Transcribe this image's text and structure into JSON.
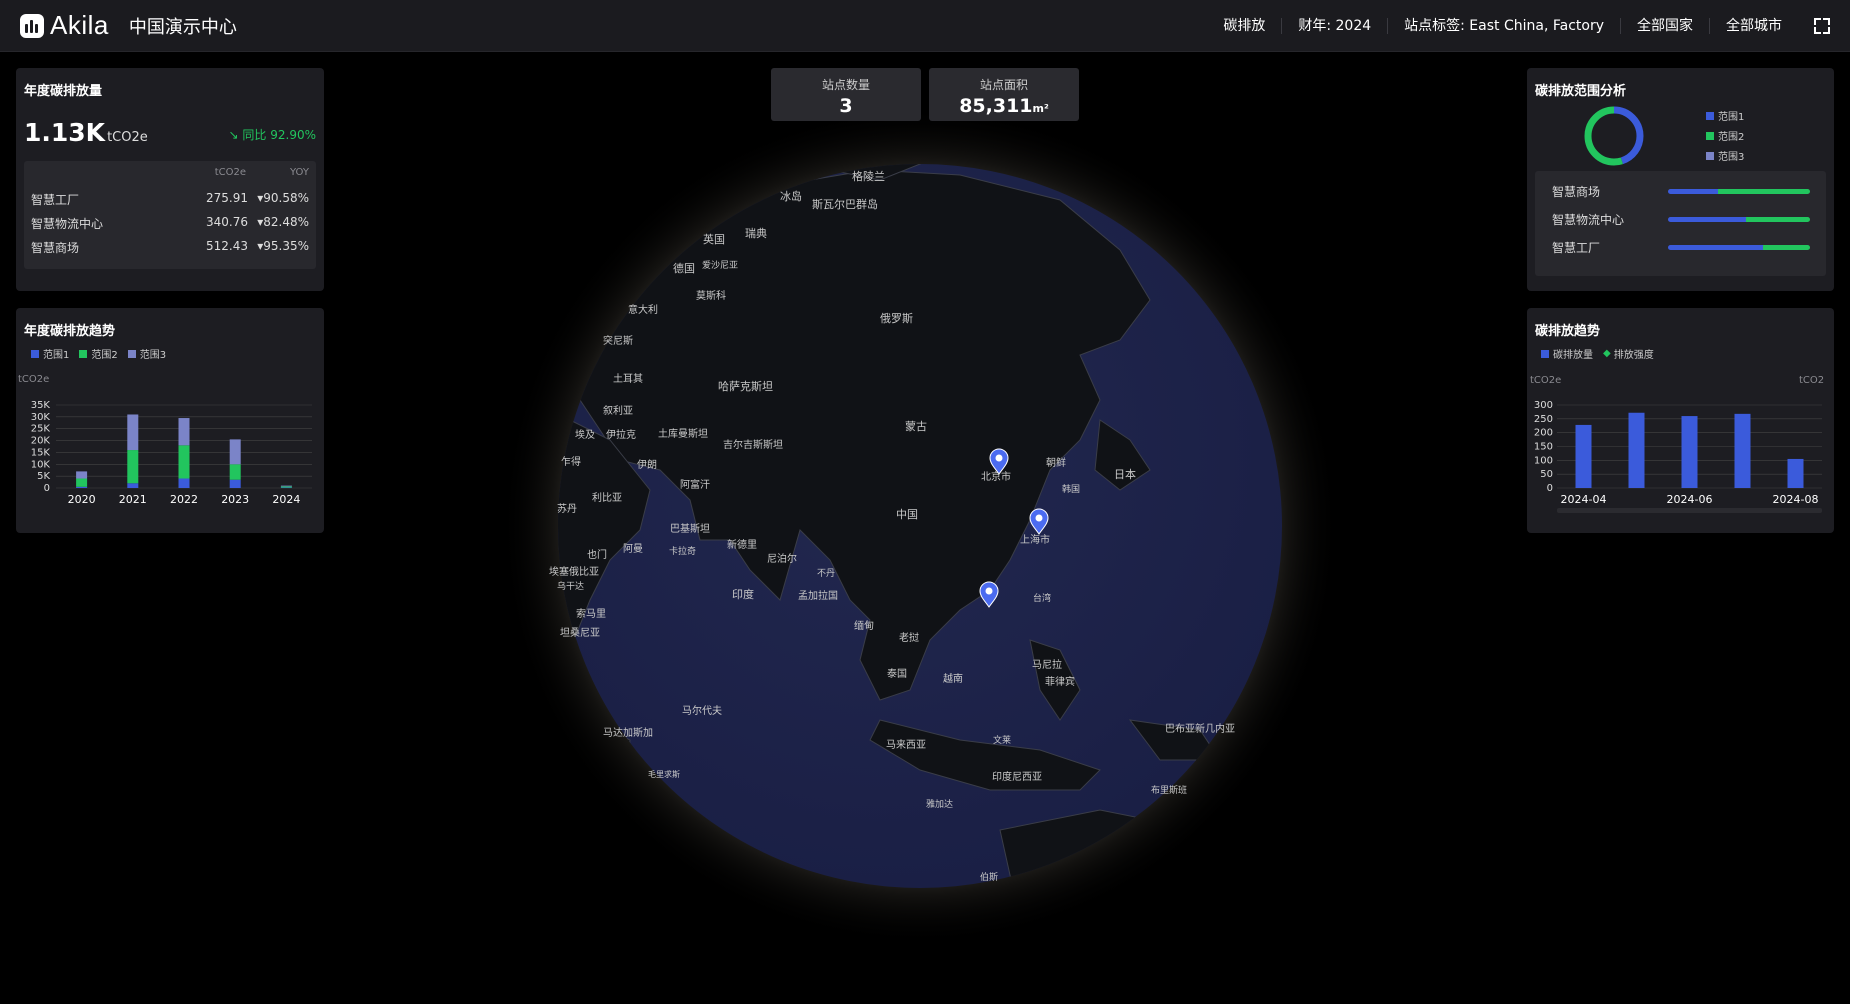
{
  "header": {
    "brand": "Akila",
    "site_title": "中国演示中心",
    "filters": [
      "碳排放",
      "财年: 2024",
      "站点标签: East China, Factory",
      "全部国家",
      "全部城市"
    ]
  },
  "annual_emission": {
    "title": "年度碳排放量",
    "value": "1.13K",
    "unit": "tCO2e",
    "yoy": "同比 92.90%",
    "col_unit": "tCO2e",
    "col_yoy": "YOY",
    "rows": [
      {
        "name": "智慧工厂",
        "value": "275.91",
        "yoy": "▾90.58%"
      },
      {
        "name": "智慧物流中心",
        "value": "340.76",
        "yoy": "▾82.48%"
      },
      {
        "name": "智慧商场",
        "value": "512.43",
        "yoy": "▾95.35%"
      }
    ]
  },
  "annual_trend": {
    "title": "年度碳排放趋势",
    "legend": [
      "范围1",
      "范围2",
      "范围3"
    ],
    "unit": "tCO2e"
  },
  "kpis": [
    {
      "label": "站点数量",
      "value": "3",
      "unit": ""
    },
    {
      "label": "站点面积",
      "value": "85,311",
      "unit": "m²"
    }
  ],
  "scope_analysis": {
    "title": "碳排放范围分析",
    "legend": [
      "范围1",
      "范围2",
      "范围3"
    ],
    "donut": {
      "scope1": 0.45,
      "scope2": 0.55,
      "scope3": 0.0
    },
    "sites": [
      {
        "name": "智慧商场",
        "scope1": 0.35,
        "scope2": 0.65
      },
      {
        "name": "智慧物流中心",
        "scope1": 0.55,
        "scope2": 0.45
      },
      {
        "name": "智慧工厂",
        "scope1": 0.67,
        "scope2": 0.33
      }
    ]
  },
  "emission_trend": {
    "title": "碳排放趋势",
    "legend": [
      "碳排放量",
      "排放强度"
    ],
    "unit_left": "tCO2e",
    "unit_right": "tCO2"
  },
  "map": {
    "labels": [
      "格陵兰",
      "冰岛",
      "斯瓦尔巴群岛",
      "瑞典",
      "英国",
      "德国",
      "爱沙尼亚",
      "莫斯科",
      "俄罗斯",
      "意大利",
      "突尼斯",
      "土耳其",
      "哈萨克斯坦",
      "叙利亚",
      "伊拉克",
      "土库曼斯坦",
      "吉尔吉斯斯坦",
      "蒙古",
      "北京市",
      "朝鲜",
      "日本",
      "韩国",
      "埃及",
      "伊朗",
      "阿富汗",
      "中国",
      "上海市",
      "乍得",
      "利比亚",
      "巴基斯坦",
      "新德里",
      "尼泊尔",
      "不丹",
      "印度",
      "孟加拉国",
      "台湾",
      "苏丹",
      "也门",
      "阿曼",
      "卡拉奇",
      "埃塞俄比亚",
      "乌干达",
      "索马里",
      "坦桑尼亚",
      "缅甸",
      "老挝",
      "泰国",
      "越南",
      "马尼拉",
      "菲律宾",
      "马尔代夫",
      "马来西亚",
      "文莱",
      "巴布亚新几内亚",
      "马达加斯加",
      "毛里求斯",
      "印度尼西亚",
      "雅加达",
      "布里斯班",
      "伯斯"
    ]
  },
  "colors": {
    "scope1": "#3b5bdb",
    "scope2": "#22c55e",
    "scope3": "#7b84c8",
    "intensity": "#22c55e"
  },
  "chart_data": [
    {
      "type": "bar",
      "stacked": true,
      "title": "年度碳排放趋势",
      "categories": [
        "2020",
        "2021",
        "2022",
        "2023",
        "2024"
      ],
      "series": [
        {
          "name": "范围1",
          "values": [
            500,
            2000,
            4000,
            3500,
            200
          ]
        },
        {
          "name": "范围2",
          "values": [
            3500,
            14000,
            14000,
            6500,
            500
          ]
        },
        {
          "name": "范围3",
          "values": [
            3000,
            15000,
            11500,
            10500,
            300
          ]
        }
      ],
      "ylabel": "tCO2e",
      "ylim": [
        0,
        35000
      ],
      "yticks": [
        "0",
        "5K",
        "10K",
        "15K",
        "20K",
        "25K",
        "30K",
        "35K"
      ],
      "grid": true,
      "legend": "top-left"
    },
    {
      "type": "bar",
      "title": "碳排放趋势",
      "categories": [
        "2024-04",
        "2024-05",
        "2024-06",
        "2024-07",
        "2024-08"
      ],
      "x_tick_labels": [
        "2024-04",
        "2024-06",
        "2024-08"
      ],
      "series": [
        {
          "name": "碳排放量",
          "values": [
            228,
            272,
            260,
            268,
            105
          ]
        },
        {
          "name": "排放强度",
          "values": []
        }
      ],
      "ylabel": "tCO2e",
      "ylim": [
        0,
        300
      ],
      "yticks": [
        "0",
        "50",
        "100",
        "150",
        "200",
        "250",
        "300"
      ],
      "grid": true,
      "legend": "top-left"
    }
  ]
}
